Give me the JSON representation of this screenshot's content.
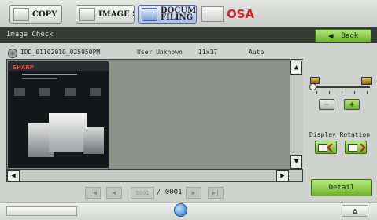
{
  "tabs": {
    "copy": "COPY",
    "image_send": "IMAGE SEND",
    "document_filing_line1": "DOCUMENT",
    "document_filing_line2": "FILING",
    "osa": "OSA"
  },
  "window": {
    "title": "Image Check",
    "back_label": "Back"
  },
  "file_info": {
    "file_name": "IDD_01102010_025950PM",
    "user": "User Unknown",
    "paper_size": "11x17",
    "color_mode": "Auto"
  },
  "preview": {
    "brand": "SHARP"
  },
  "pagination": {
    "current_page": "0001",
    "total_pages": "/ 0001"
  },
  "zoom": {
    "out_label": "−",
    "in_label": "+"
  },
  "rotation": {
    "label": "Display Rotation"
  },
  "detail_label": "Detail",
  "icons": {
    "copy": "copier-icon",
    "image_send": "scanner-icon",
    "document_filing": "folder-icon",
    "osa": "osa-icon",
    "back": "arrow-left-icon",
    "zoom_small": "image-small-icon",
    "zoom_large": "image-large-icon",
    "rotate_left": "rotate-left-icon",
    "rotate_right": "rotate-right-icon",
    "globe": "globe-icon",
    "settings": "gear-icon"
  },
  "colors": {
    "accent_green": "#6fb32c",
    "title_bar": "#353a33",
    "active_tab": "#aec0e2",
    "brand_red": "#d2252c"
  }
}
